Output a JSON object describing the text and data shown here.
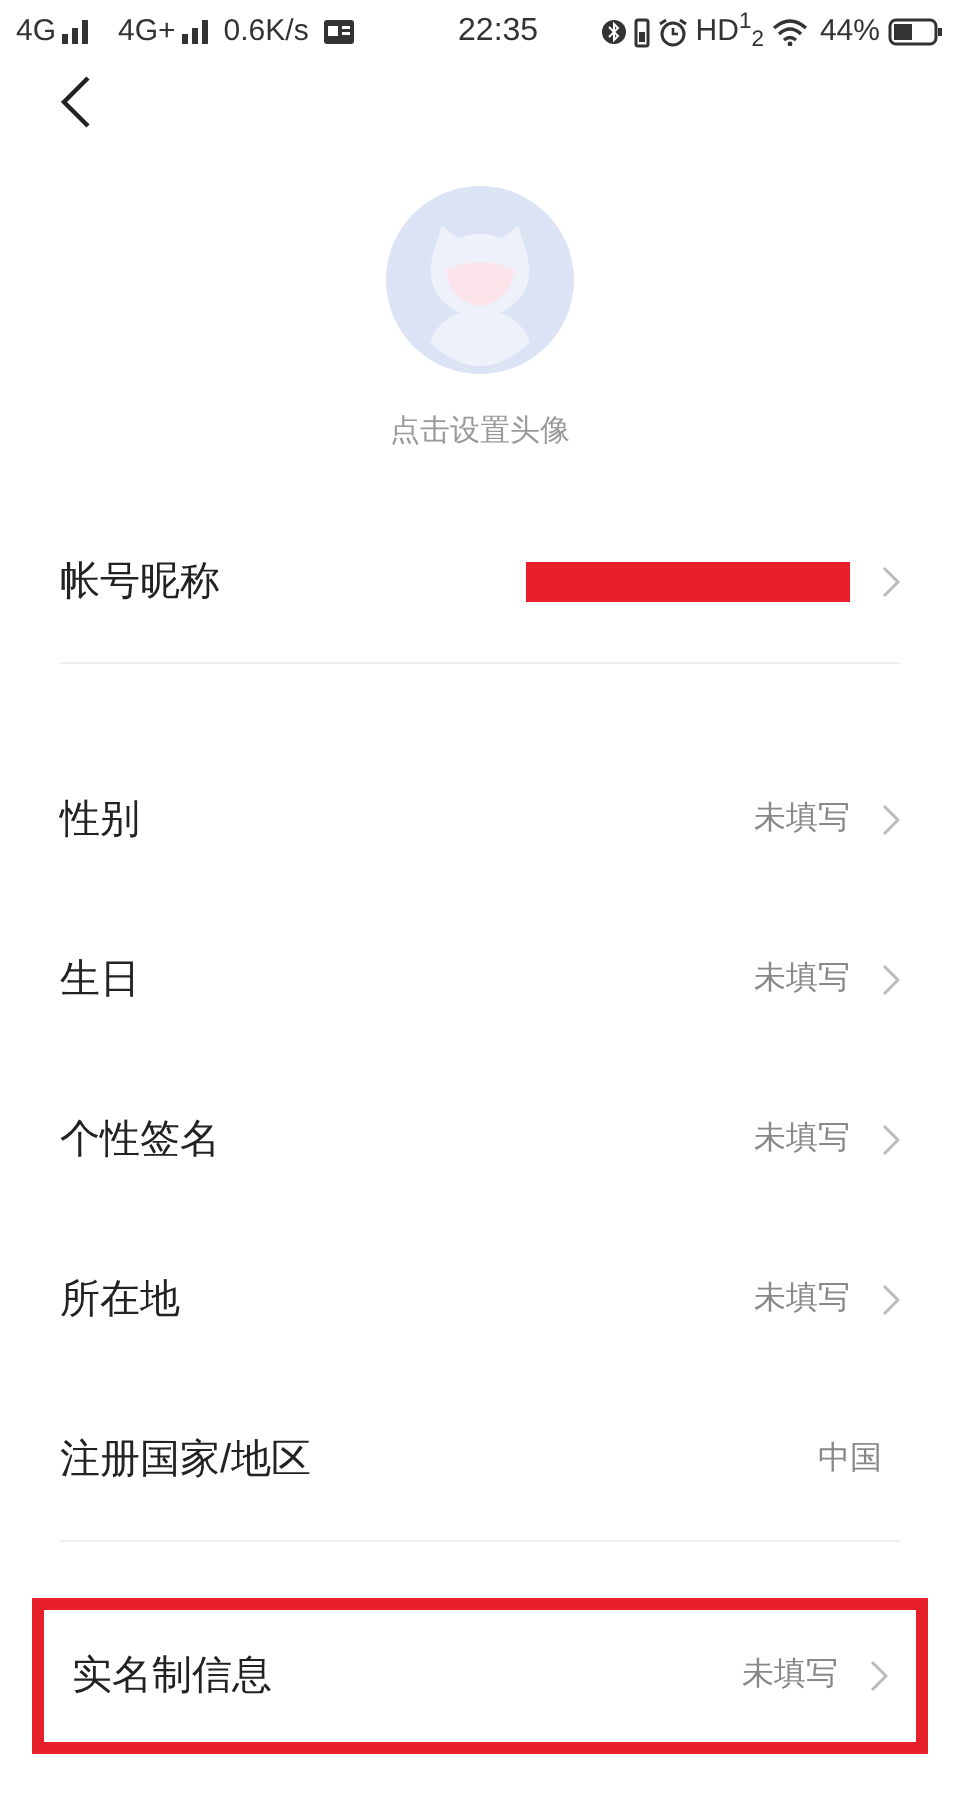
{
  "status_bar": {
    "network_1": "4G",
    "network_2": "4G+",
    "speed": "0.6K/s",
    "time": "22:35",
    "hd": "HD$^{1}$$_{2}$",
    "battery": "44%"
  },
  "avatar": {
    "caption": "点击设置头像"
  },
  "sections": [
    {
      "rows": [
        {
          "label": "帐号昵称",
          "value_redacted": true,
          "has_arrow": true,
          "highlighted": false
        }
      ]
    },
    {
      "rows": [
        {
          "label": "性别",
          "value": "未填写",
          "has_arrow": true,
          "highlighted": false
        },
        {
          "label": "生日",
          "value": "未填写",
          "has_arrow": true,
          "highlighted": false
        },
        {
          "label": "个性签名",
          "value": "未填写",
          "has_arrow": true,
          "highlighted": false
        },
        {
          "label": "所在地",
          "value": "未填写",
          "has_arrow": true,
          "highlighted": false
        },
        {
          "label": "注册国家/地区",
          "value": "中国",
          "has_arrow": false,
          "highlighted": false
        }
      ]
    },
    {
      "rows": [
        {
          "label": "实名制信息",
          "value": "未填写",
          "has_arrow": true,
          "highlighted": true
        }
      ]
    }
  ]
}
